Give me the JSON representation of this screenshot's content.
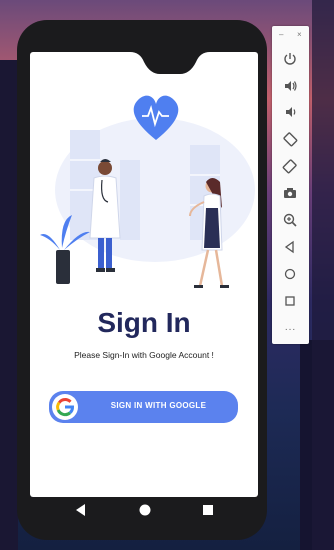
{
  "app": {
    "title": "Sign In",
    "subtitle": "Please Sign-In with Google Account !",
    "google_button_label": "SIGN IN WITH GOOGLE"
  },
  "navbar": {
    "back_icon": "back-triangle-icon",
    "home_icon": "home-circle-icon",
    "recents_icon": "recents-square-icon"
  },
  "emulator_toolbar": {
    "minimize": "–",
    "close": "×",
    "more": "...",
    "buttons": [
      "power-icon",
      "volume-up-icon",
      "volume-down-icon",
      "rotate-left-icon",
      "rotate-right-icon",
      "camera-icon",
      "zoom-icon",
      "back-icon",
      "home-icon",
      "overview-icon"
    ]
  },
  "colors": {
    "accent": "#5b82ee",
    "title": "#22285c",
    "illustration_blue": "#4f7ff0"
  }
}
